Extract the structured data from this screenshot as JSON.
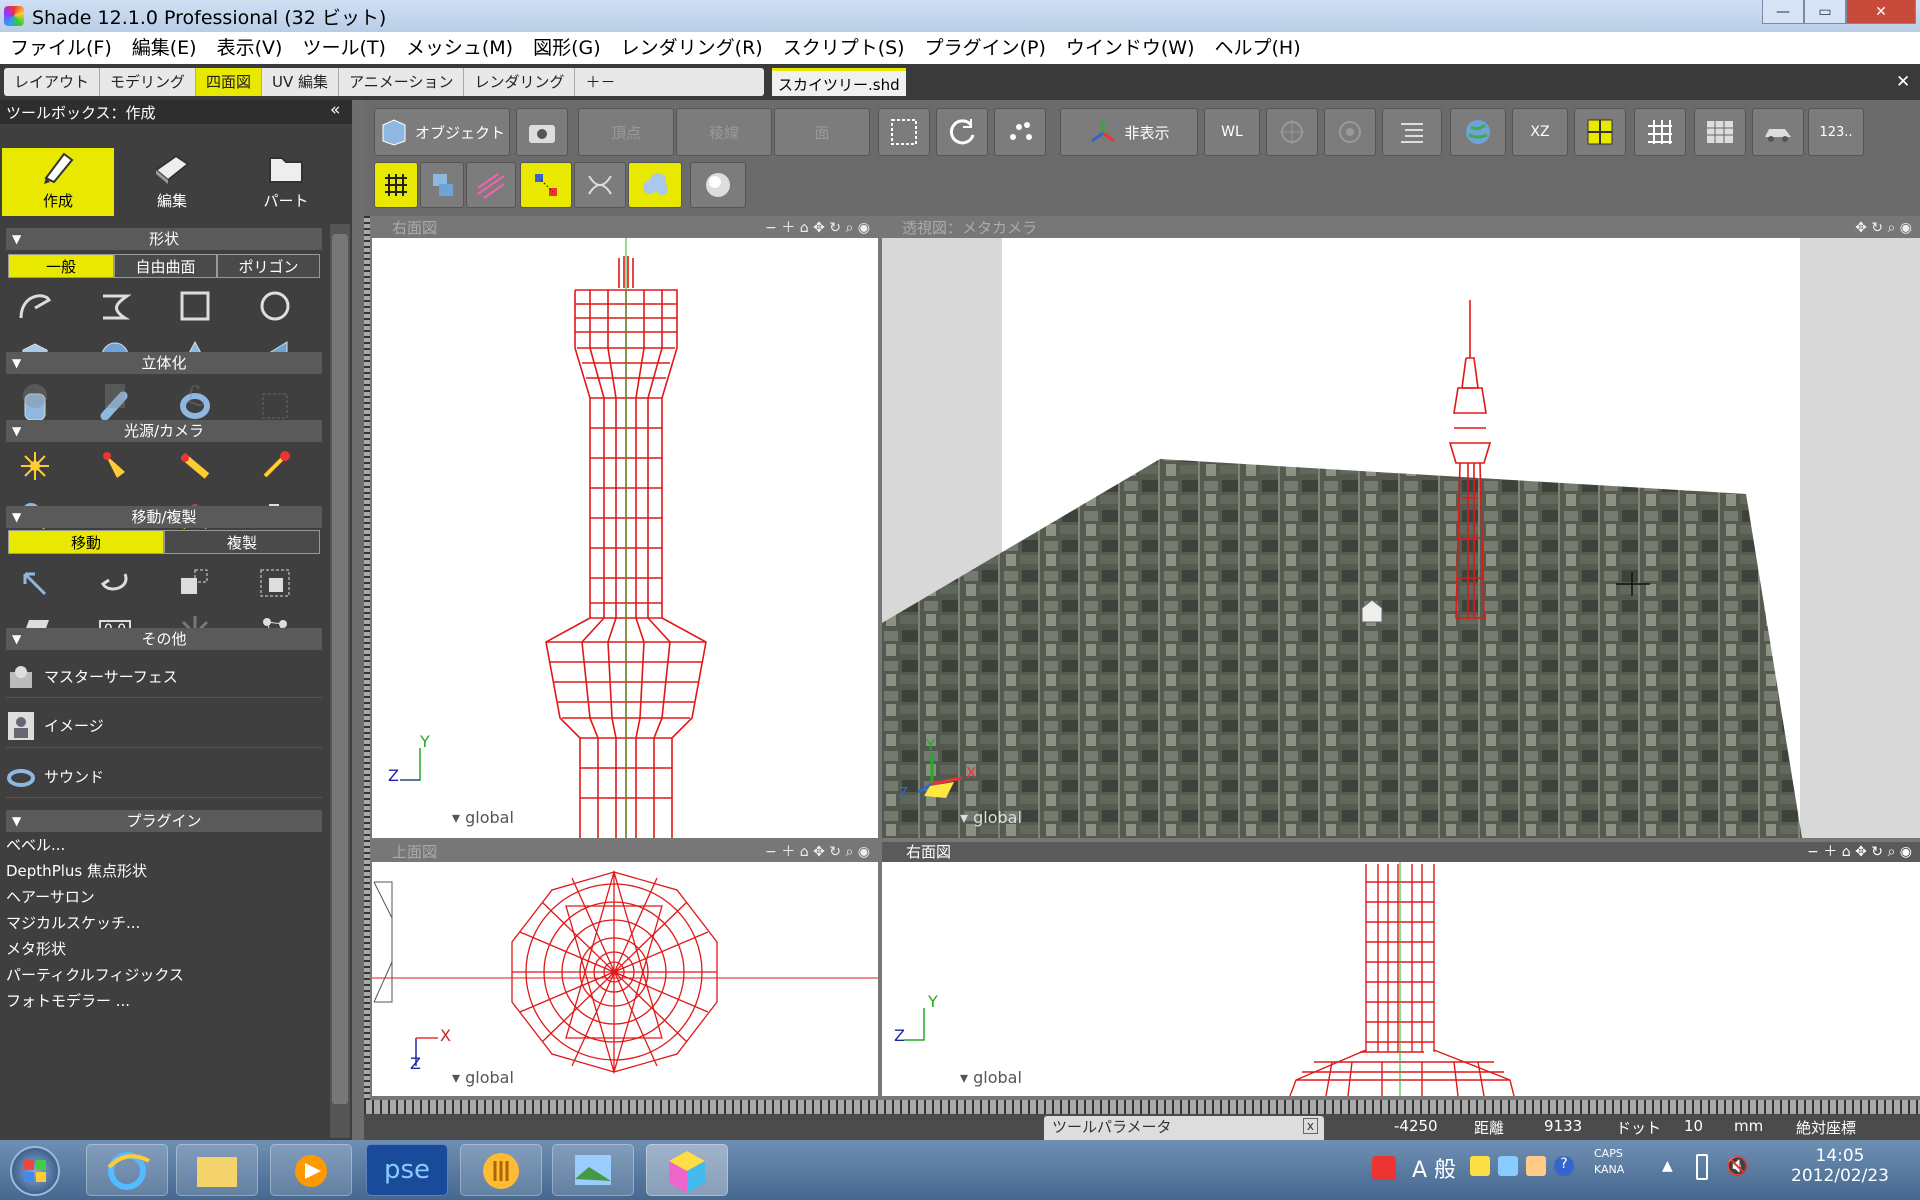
{
  "window": {
    "title": "Shade 12.1.0 Professional (32 ビット)",
    "minimize": "—",
    "maximize": "▭",
    "close": "✕"
  },
  "menu": [
    "ファイル(F)",
    "編集(E)",
    "表示(V)",
    "ツール(T)",
    "メッシュ(M)",
    "図形(G)",
    "レンダリング(R)",
    "スクリプト(S)",
    "プラグイン(P)",
    "ウインドウ(W)",
    "ヘルプ(H)"
  ],
  "mode_tabs": [
    {
      "label": "レイアウト",
      "active": false
    },
    {
      "label": "モデリング",
      "active": false
    },
    {
      "label": "四面図",
      "active": true
    },
    {
      "label": "UV 編集",
      "active": false
    },
    {
      "label": "アニメーション",
      "active": false
    },
    {
      "label": "レンダリング",
      "active": false
    },
    {
      "label": "＋－",
      "active": false
    }
  ],
  "document_tab": {
    "label": "スカイツリー.shd",
    "close": "✕"
  },
  "panel_close": "✕",
  "toolbox": {
    "title": "ツールボックス：作成",
    "collapse": "«",
    "big_tabs": [
      "作成",
      "編集",
      "パート"
    ],
    "sections": {
      "shape": "形状",
      "solidify": "立体化",
      "light": "光源/カメラ",
      "move": "移動/複製",
      "other": "その他",
      "plugin": "プラグイン"
    },
    "shape_tabs": [
      "一般",
      "自由曲面",
      "ポリゴン"
    ],
    "move_tabs": [
      "移動",
      "複製"
    ],
    "other_items": [
      "マスターサーフェス",
      "イメージ",
      "サウンド"
    ],
    "plugin_items": [
      "ベベル...",
      "DepthPlus 焦点形状",
      "ヘアーサロン",
      "マジカルスケッチ...",
      "メタ形状",
      "パーティクルフィジックス",
      "フォトモデラー ..."
    ],
    "numeric_icon": "0.0"
  },
  "toolbar": {
    "object": "オブジェクト",
    "vertex": "頂点",
    "edge": "稜線",
    "face": "面",
    "hide": "非表示",
    "wl": "WL",
    "xz": "XZ",
    "num": "123.."
  },
  "viewports": {
    "front": {
      "title": "右面図",
      "global": "global",
      "axis_y": "Y",
      "axis_z": "Z"
    },
    "perspective": {
      "title": "透視図：メタカメラ",
      "global": "global",
      "axis_y": "Y",
      "axis_x": "X",
      "axis_z": "Z"
    },
    "top": {
      "title": "上面図",
      "global": "global",
      "axis_x": "X",
      "axis_z": "Z"
    },
    "right": {
      "title": "右面図",
      "global": "global",
      "axis_y": "Y",
      "axis_z": "Z"
    }
  },
  "status": {
    "tool_param": "ツールパラメータ",
    "tool_param_close": "x",
    "coord": "-4250",
    "dist_label": "距離",
    "dist_val": "9133",
    "dot_label": "ドット",
    "dot_val": "10",
    "unit": "mm",
    "coord_mode": "絶対座標"
  },
  "taskbar": {
    "time": "14:05",
    "date": "2012/02/23",
    "pse": "pse",
    "ime": "A 般",
    "caps": "CAPS",
    "kana": "KANA"
  },
  "colors": {
    "accent_yellow": "#e8e800",
    "wire_red": "#e01818",
    "panel_dark": "#3f3f3f",
    "toolbar_grey": "#6b6b6b"
  }
}
